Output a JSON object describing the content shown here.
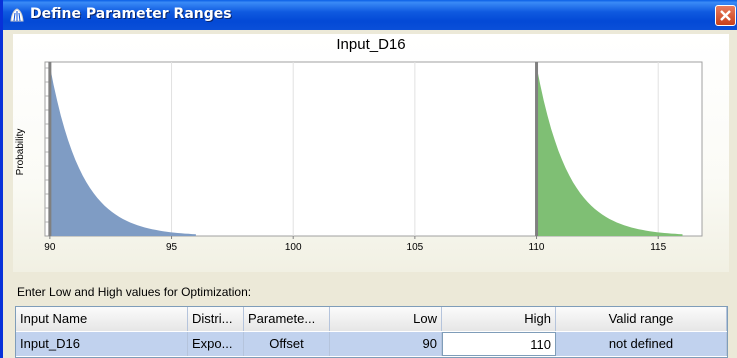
{
  "window": {
    "title": "Define Parameter Ranges",
    "accent": "#0a4fd8"
  },
  "chart": {
    "title": "Input_D16",
    "ylabel": "Probability",
    "ticks": [
      "90",
      "95",
      "100",
      "105",
      "110",
      "115"
    ]
  },
  "chart_data": {
    "type": "area",
    "title": "Input_D16",
    "xlabel": "",
    "ylabel": "Probability",
    "xlim": [
      89.8,
      116.8
    ],
    "x_ticks": [
      90,
      95,
      100,
      105,
      110,
      115
    ],
    "grid": true,
    "series": [
      {
        "color": "#7f9cc4",
        "x_start": 90,
        "x_end": 96,
        "shape": "exponential-decay"
      },
      {
        "color": "#7fbf74",
        "x_start": 110,
        "x_end": 116,
        "shape": "exponential-decay"
      }
    ],
    "markers": [
      90,
      110
    ]
  },
  "instructions": "Enter Low and High values for Optimization:",
  "table": {
    "headers": [
      "Input Name",
      "Distri...",
      "Paramete...",
      "Low",
      "High",
      "Valid range"
    ],
    "rows": [
      [
        "Input_D16",
        "Expo...",
        "Offset",
        "90",
        "110",
        "not defined"
      ]
    ]
  }
}
